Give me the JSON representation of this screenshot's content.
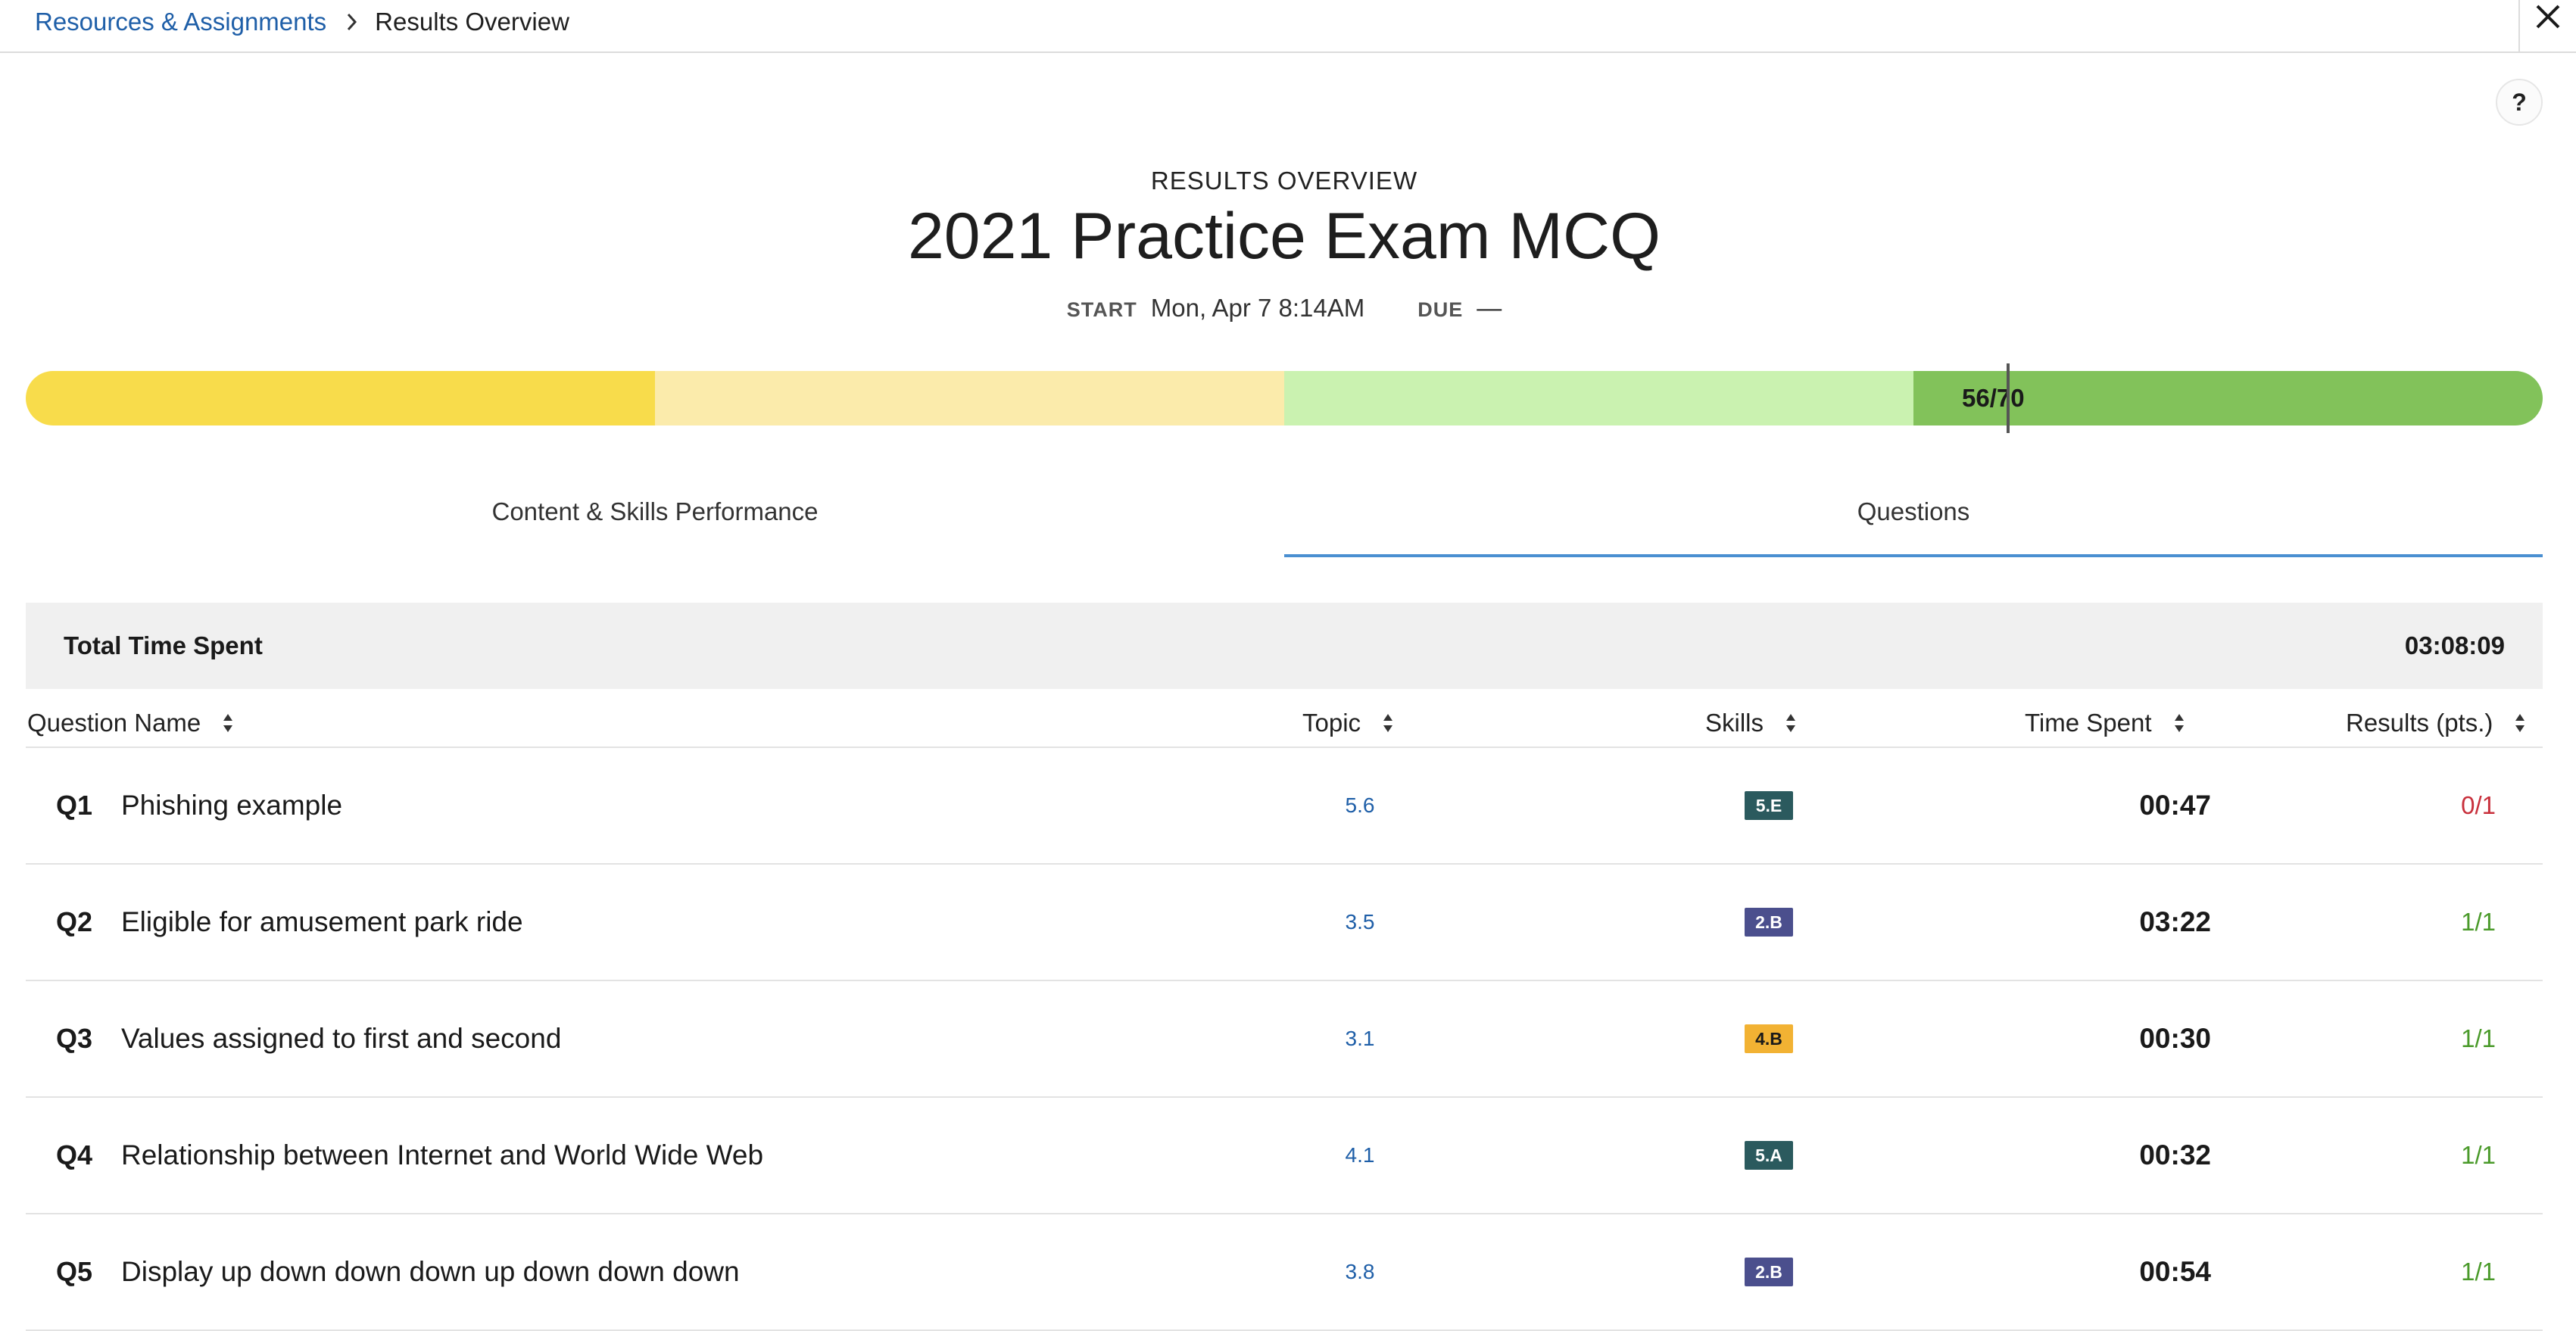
{
  "breadcrumb": {
    "parent": "Resources & Assignments",
    "current": "Results Overview"
  },
  "header": {
    "overline": "RESULTS OVERVIEW",
    "title": "2021 Practice Exam MCQ",
    "start_label": "START",
    "start_value": "Mon, Apr 7 8:14AM",
    "due_label": "DUE",
    "due_value": "—"
  },
  "help": {
    "label": "?"
  },
  "score": {
    "text": "56/70",
    "earned": 56,
    "total": 70,
    "colors": [
      "#f8dc4b",
      "#fbebab",
      "#caf2b0",
      "#82c25a"
    ]
  },
  "tabs": [
    {
      "label": "Content & Skills Performance",
      "active": false
    },
    {
      "label": "Questions",
      "active": true
    }
  ],
  "total_time": {
    "label": "Total Time Spent",
    "value": "03:08:09"
  },
  "table": {
    "columns": {
      "question": "Question Name",
      "topic": "Topic",
      "skills": "Skills",
      "time": "Time Spent",
      "results": "Results (pts.)"
    },
    "rows": [
      {
        "num": "Q1",
        "name": "Phishing example",
        "topic": "5.6",
        "skill": "5.E",
        "skill_color": "#2b5a5e",
        "skill_text_color": "#ffffff",
        "time": "00:47",
        "result": "0/1",
        "result_color": "#c8303c"
      },
      {
        "num": "Q2",
        "name": "Eligible for amusement park ride",
        "topic": "3.5",
        "skill": "2.B",
        "skill_color": "#4b4f8d",
        "skill_text_color": "#ffffff",
        "time": "03:22",
        "result": "1/1",
        "result_color": "#4a9a2a"
      },
      {
        "num": "Q3",
        "name": "Values assigned to first and second",
        "topic": "3.1",
        "skill": "4.B",
        "skill_color": "#f2b233",
        "skill_text_color": "#1a1a1a",
        "time": "00:30",
        "result": "1/1",
        "result_color": "#4a9a2a"
      },
      {
        "num": "Q4",
        "name": "Relationship between Internet and World Wide Web",
        "topic": "4.1",
        "skill": "5.A",
        "skill_color": "#2b5a5e",
        "skill_text_color": "#ffffff",
        "time": "00:32",
        "result": "1/1",
        "result_color": "#4a9a2a"
      },
      {
        "num": "Q5",
        "name": "Display up down down down up down down down",
        "topic": "3.8",
        "skill": "2.B",
        "skill_color": "#4b4f8d",
        "skill_text_color": "#ffffff",
        "time": "00:54",
        "result": "1/1",
        "result_color": "#4a9a2a"
      }
    ]
  }
}
